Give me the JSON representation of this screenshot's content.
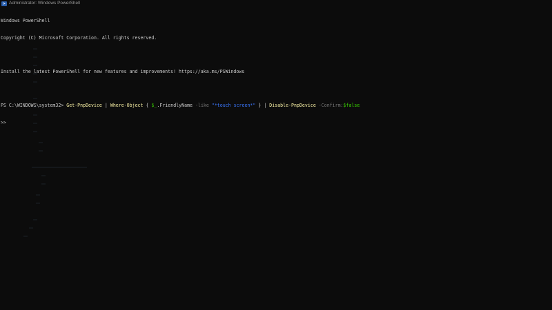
{
  "window": {
    "title": "Administrator: Windows PowerShell",
    "icon": "powershell-icon"
  },
  "console": {
    "header_line_1": "Windows PowerShell",
    "header_line_2": "Copyright (C) Microsoft Corporation. All rights reserved.",
    "install_line": "Install the latest PowerShell for new features and improvements! https://aka.ms/PSWindows",
    "prompt": "PS C:\\WINDOWS\\system32>",
    "command": {
      "cmdlet1": "Get-PnpDevice",
      "pipe1": "|",
      "cmdlet2": "Where-Object",
      "brace_open": "{",
      "var": "$_",
      "property": ".FriendlyName",
      "operator": "-like",
      "string": "\"*touch screen*\"",
      "brace_close": "}",
      "pipe2": "|",
      "cmdlet3": "Disable-PnpDevice",
      "param": "-Confirm:",
      "param_value": "$false"
    },
    "continuation_prompt": ">>"
  },
  "colors": {
    "background": "#0c0c0c",
    "text": "#cccccc",
    "cmdlet": "#f9f1a5",
    "variable": "#3ad900",
    "parameter": "#767676",
    "string": "#3b78ff"
  }
}
